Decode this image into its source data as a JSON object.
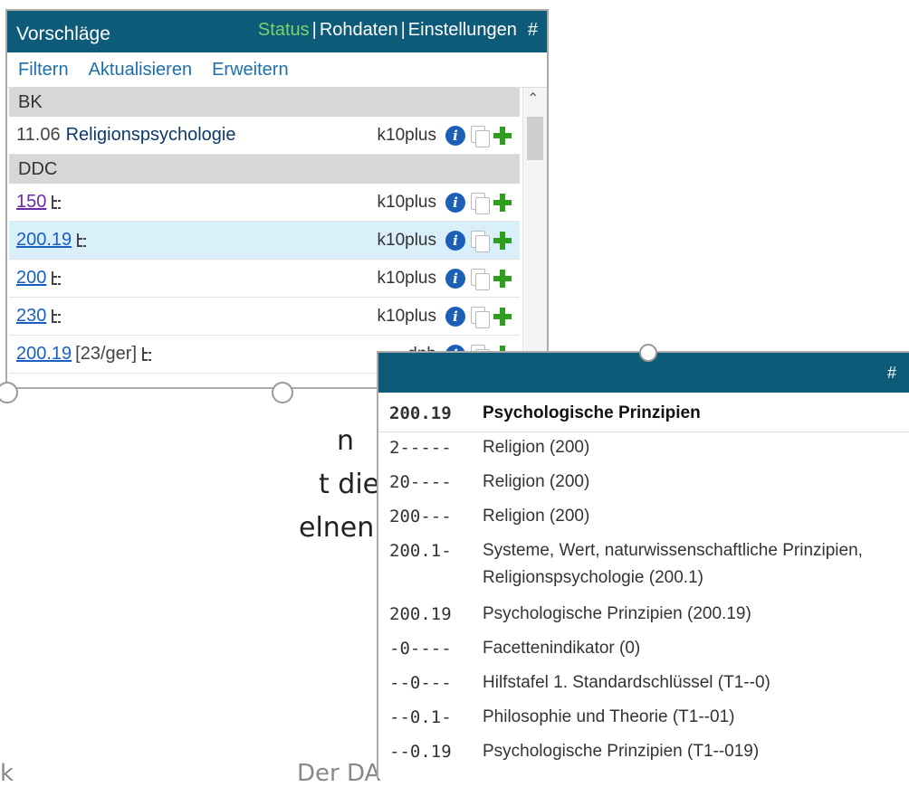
{
  "background_slide": {
    "fragments": [
      "n",
      "t die",
      "elnen"
    ],
    "footer_left": "k",
    "footer_right": "Der DA"
  },
  "suggestions_panel": {
    "title": "Vorschläge",
    "header_links": [
      {
        "label": "Status",
        "color": "#7dd36c"
      },
      {
        "label": "Rohdaten"
      },
      {
        "label": "Einstellungen"
      }
    ],
    "hash": "#",
    "toolbar": [
      "Filtern",
      "Aktualisieren",
      "Erweitern"
    ],
    "groups": [
      {
        "name": "BK",
        "rows": [
          {
            "code": "11.06",
            "label": "Religionspsychologie",
            "source": "k10plus"
          }
        ]
      },
      {
        "name": "DDC",
        "rows": [
          {
            "notation": "150",
            "source": "k10plus",
            "visited": true
          },
          {
            "notation": "200.19",
            "source": "k10plus",
            "selected": true
          },
          {
            "notation": "200",
            "source": "k10plus"
          },
          {
            "notation": "230",
            "source": "k10plus"
          },
          {
            "notation": "200.19",
            "extra": "[23/ger]",
            "source": "dnb"
          }
        ]
      }
    ],
    "colors": {
      "header": "#0d5a79",
      "group": "#d7d7d7",
      "selected": "#d9effa",
      "link": "#1a5fc2",
      "add": "#2f9d1e",
      "info": "#1c5fb6"
    }
  },
  "hierarchy_panel": {
    "hash": "#",
    "heading": {
      "notation": "200.19",
      "label": "Psychologische Prinzipien"
    },
    "rows": [
      {
        "notation": "2-----",
        "label": "Religion (200)"
      },
      {
        "notation": "20----",
        "label": "Religion (200)"
      },
      {
        "notation": "200---",
        "label": "Religion (200)"
      },
      {
        "notation": "200.1-",
        "label": "Systeme, Wert, naturwissenschaftliche Prinzipien, Religionspsychologie (200.1)"
      },
      {
        "notation": "200.19",
        "label": "Psychologische Prinzipien (200.19)"
      },
      {
        "notation": "-0----",
        "label": "Facettenindikator (0)"
      },
      {
        "notation": "--0---",
        "label": "Hilfstafel 1. Standardschlüssel (T1--0)"
      },
      {
        "notation": "--0.1-",
        "label": "Philosophie und Theorie (T1--01)"
      },
      {
        "notation": "--0.19",
        "label": "Psychologische Prinzipien (T1--019)"
      }
    ]
  }
}
